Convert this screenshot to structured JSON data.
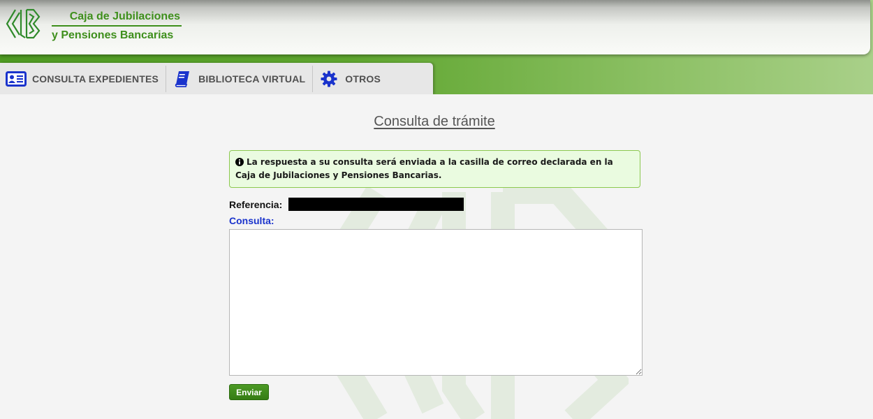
{
  "header": {
    "org_line1": "Caja de Jubilaciones",
    "org_line2": "y Pensiones Bancarias",
    "logo_icon": "cjb-logo-icon"
  },
  "nav": {
    "tabs": [
      {
        "label": "CONSULTA EXPEDIENTES",
        "icon": "id-card-icon"
      },
      {
        "label": "BIBLIOTECA VIRTUAL",
        "icon": "book-icon"
      },
      {
        "label": "OTROS",
        "icon": "gear-icon"
      }
    ]
  },
  "main": {
    "title": "Consulta de trámite",
    "info_message": "La respuesta a su consulta será enviada a la casilla de correo declarada en la Caja de Jubilaciones y Pensiones Bancarias.",
    "reference_label": "Referencia:",
    "reference_value": "",
    "consulta_label": "Consulta:",
    "consulta_value": "",
    "submit_label": "Enviar"
  },
  "colors": {
    "brand_green": "#3e8f1c",
    "accent_blue": "#1a33cc",
    "info_bg": "#eafbe0",
    "info_border": "#8cc84f"
  }
}
